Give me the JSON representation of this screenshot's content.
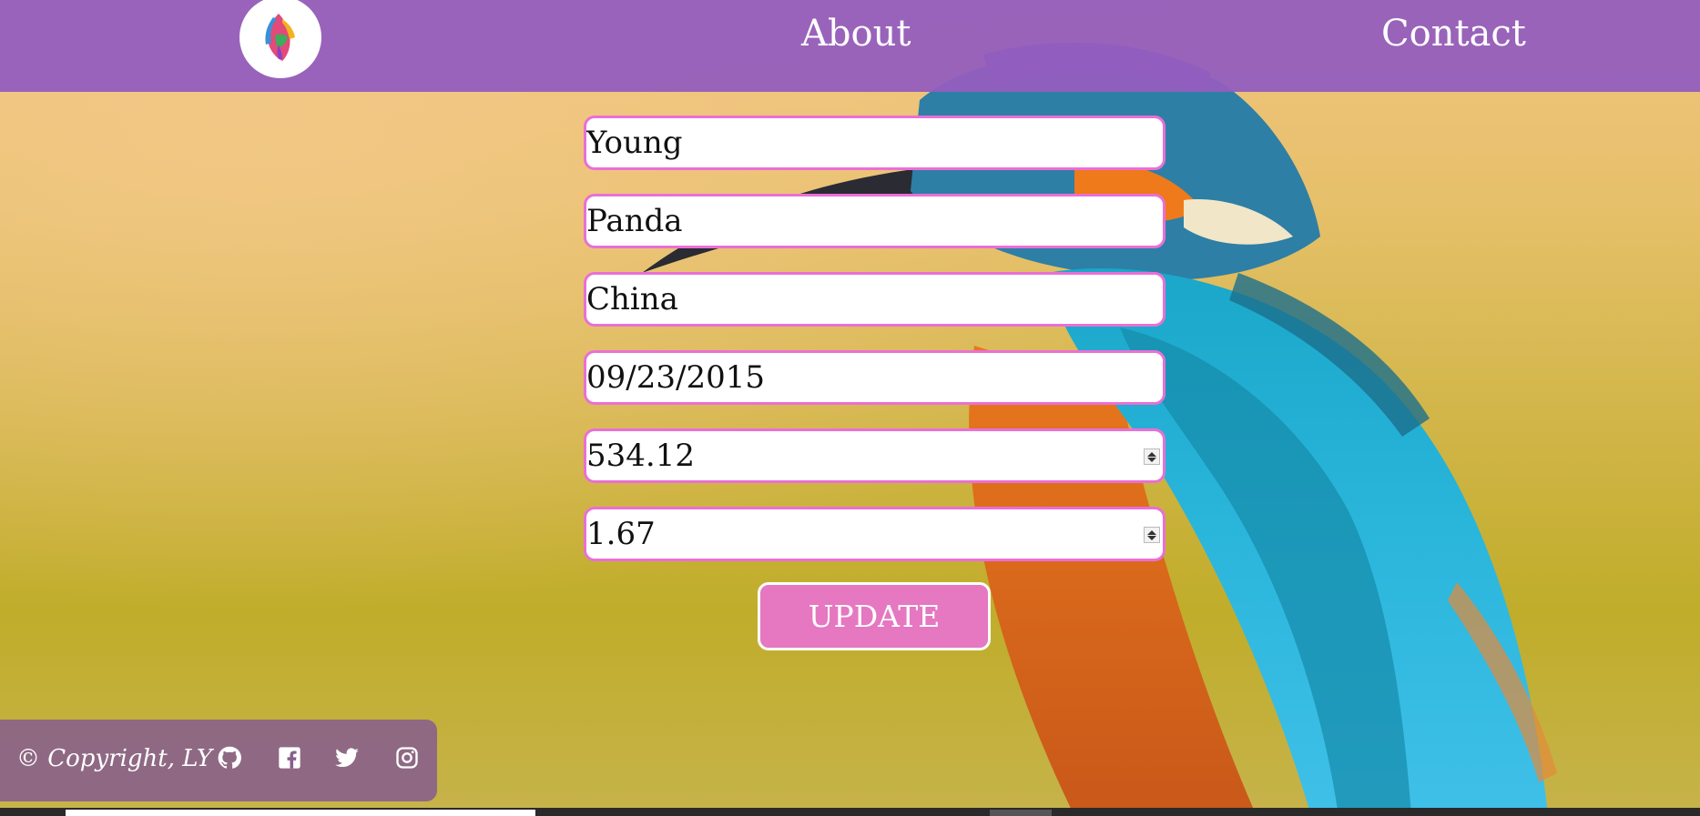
{
  "nav": {
    "about_label": "About",
    "contact_label": "Contact",
    "logo_icon": "lion-logo-icon"
  },
  "form": {
    "first_name": "Young",
    "last_name": "Panda",
    "country": "China",
    "date": "09/23/2015",
    "amount": "534.12",
    "rate": "1.67",
    "update_label": "UPDATE"
  },
  "footer": {
    "copyright": "© Copyright, LY",
    "icons": [
      "github-icon",
      "facebook-icon",
      "twitter-icon",
      "instagram-icon"
    ]
  },
  "colors": {
    "navbar": "#945ebe",
    "field_border": "#ea6fd6",
    "button": "#e578c0",
    "footer": "#875f8c"
  }
}
